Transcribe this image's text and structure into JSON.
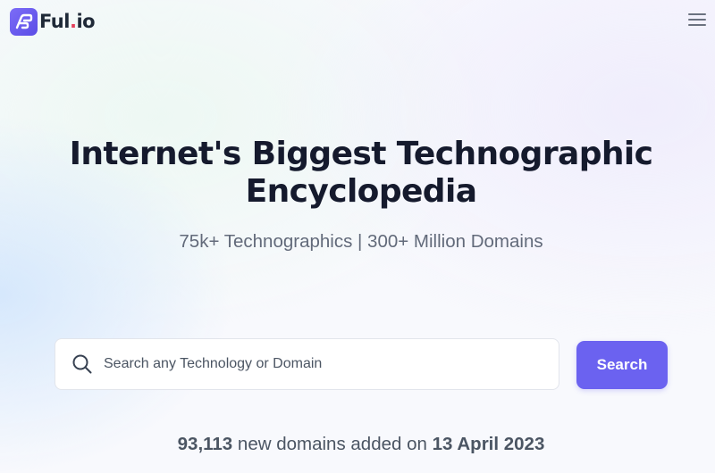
{
  "header": {
    "logo": {
      "icon": "logo-mark-icon",
      "name_main": "Ful",
      "name_dot": ".",
      "name_tld": "io",
      "accent_color": "#6b62f0",
      "dot_color": "#e4405b"
    },
    "menu_icon": "hamburger-menu-icon"
  },
  "hero": {
    "title_line1": "Internet's Biggest Technographic",
    "title_line2": "Encyclopedia",
    "subtitle": "75k+ Technographics | 300+ Million Domains"
  },
  "search": {
    "icon": "search-icon",
    "value": "",
    "placeholder": "Search any Technology or Domain",
    "button_label": "Search",
    "button_color": "#6b62f0"
  },
  "stats": {
    "count": "93,113",
    "text_middle": "new domains added on",
    "date": "13 April 2023"
  }
}
